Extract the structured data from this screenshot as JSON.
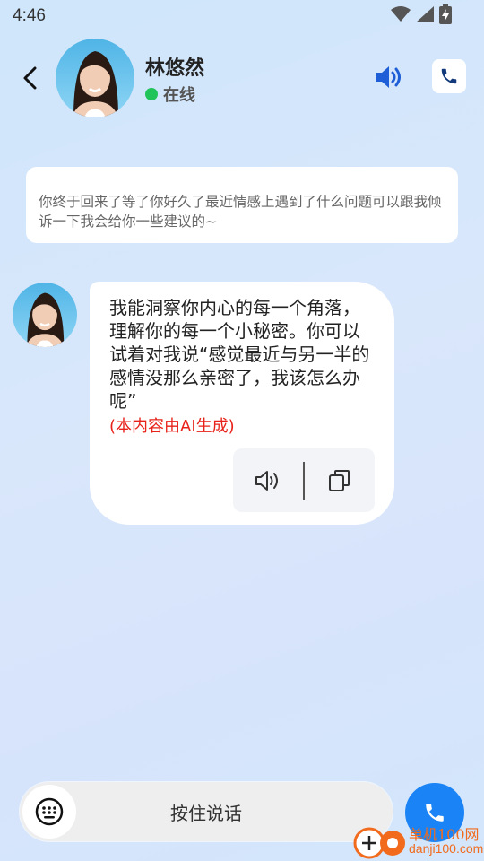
{
  "status_bar": {
    "time": "4:46",
    "icons": [
      "wifi-icon",
      "signal-icon",
      "battery-charging-icon"
    ]
  },
  "header": {
    "name": "林悠然",
    "presence": "在线",
    "presence_color": "#21c45a",
    "icons": [
      "back-arrow-icon",
      "speaker-icon",
      "phone-icon"
    ]
  },
  "intro": {
    "text": "你终于回来了等了你好久了最近情感上遇到了什么问题可以跟我倾诉一下我会给你一些建议的~"
  },
  "message": {
    "text": "我能洞察你内心的每一个角落，理解你的每一个小秘密。你可以试着对我说“感觉最近与另一半的感情没那么亲密了，我该怎么办呢”",
    "ai_note": "(本内容由AI生成)",
    "ai_note_color": "#e8221a",
    "tools": [
      "speaker-icon",
      "copy-icon"
    ]
  },
  "input_bar": {
    "hold_to_talk": "按住说话",
    "icons": [
      "keyboard-icon",
      "phone-icon"
    ],
    "accent": "#1a83f5"
  },
  "watermark": {
    "name": "单机100网",
    "url": "danji100.com"
  }
}
